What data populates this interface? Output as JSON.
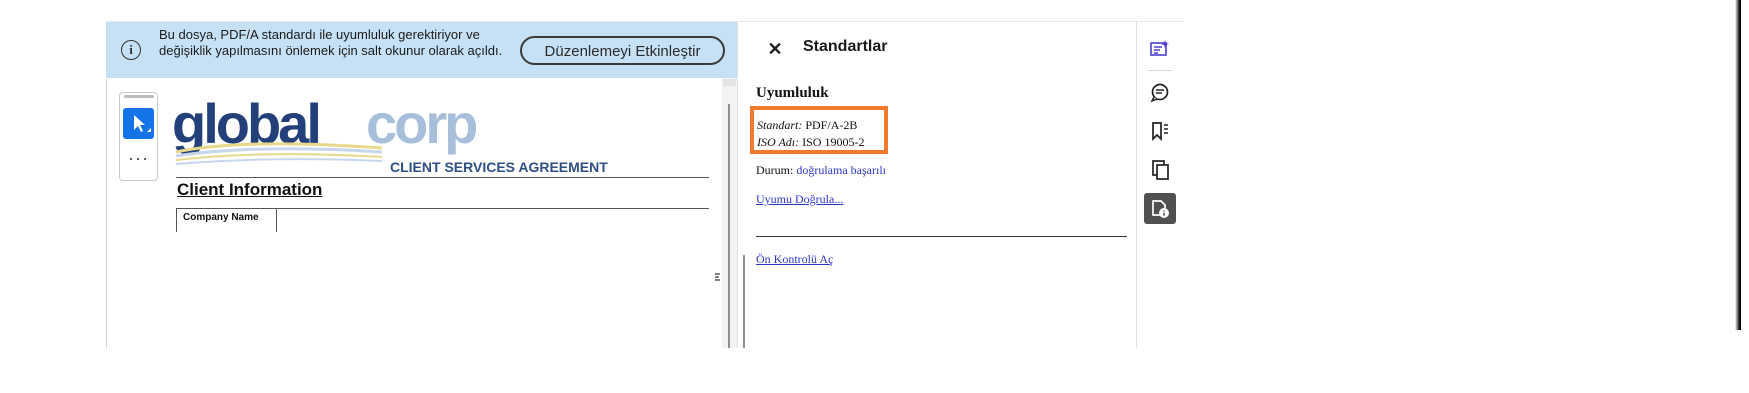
{
  "banner": {
    "message": "Bu dosya, PDF/A standardı ile uyumluluk gerektiriyor ve değişiklik yapılmasını önlemek için salt okunur olarak açıldı.",
    "enable_editing_label": "Düzenlemeyi Etkinleştir"
  },
  "document": {
    "logo_part1": "global",
    "logo_part2": "corp",
    "agreement_title": "CLIENT SERVICES AGREEMENT",
    "section_heading": "Client Information",
    "field_label": "Company Name",
    "more_tools": "···"
  },
  "panel": {
    "close_glyph": "✕",
    "title": "Standartlar",
    "section_title": "Uyumluluk",
    "standard_label": "Standart:",
    "standard_value": "PDF/A-2B",
    "iso_label": "ISO Adı:",
    "iso_value": "ISO 19005-2",
    "status_label": "Durum:",
    "status_value": "doğrulama başarılı",
    "verify_link": "Uyumu Doğrula...",
    "preflight_link": "Ön Kontrolü Aç"
  },
  "toolbar": {
    "icons": [
      "edit-pdf-icon",
      "comment-icon",
      "bookmark-icon",
      "pages-icon",
      "standards-icon"
    ],
    "active": "standards-icon"
  },
  "colors": {
    "banner_bg": "#c6e1f6",
    "accent_blue": "#1473e6",
    "highlight_orange": "#f07b2c",
    "link_blue": "#2a36c8"
  }
}
